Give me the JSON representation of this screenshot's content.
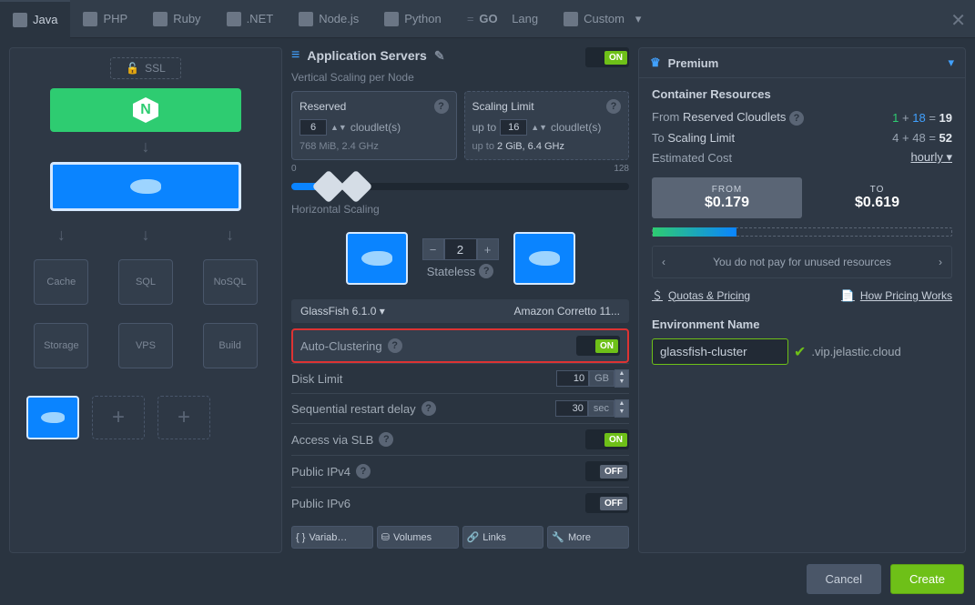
{
  "tabs": [
    "Java",
    "PHP",
    "Ruby",
    ".NET",
    "Node.js",
    "Python",
    "Lang",
    "Custom"
  ],
  "go_prefix": "GO",
  "ssl_label": "SSL",
  "app_servers": {
    "title": "Application Servers",
    "toggle": "ON",
    "vertical_subtitle": "Vertical Scaling per Node",
    "reserved": {
      "title": "Reserved",
      "value": "6",
      "unit": "cloudlet(s)",
      "foot": "768 MiB, 2.4 GHz"
    },
    "limit": {
      "title": "Scaling Limit",
      "prefix": "up to",
      "value": "16",
      "unit": "cloudlet(s)",
      "foot_prefix": "up to",
      "foot": "2 GiB, 6.4 GHz"
    },
    "slider_min": "0",
    "slider_max": "128",
    "horizontal_subtitle": "Horizontal Scaling",
    "count": "2",
    "mode": "Stateless",
    "version": "GlassFish 6.1.0",
    "jdk": "Amazon Corretto 11...",
    "auto_clustering": {
      "label": "Auto-Clustering",
      "toggle": "ON"
    },
    "disk_limit": {
      "label": "Disk Limit",
      "value": "10",
      "unit": "GB"
    },
    "restart_delay": {
      "label": "Sequential restart delay",
      "value": "30",
      "unit": "sec"
    },
    "slb": {
      "label": "Access via SLB",
      "toggle": "ON"
    },
    "ipv4": {
      "label": "Public IPv4",
      "toggle": "OFF"
    },
    "ipv6": {
      "label": "Public IPv6",
      "toggle": "OFF"
    },
    "bottom_buttons": [
      "Variab…",
      "Volumes",
      "Links",
      "More"
    ]
  },
  "topology_arrows_row": [
    "↓",
    "↓",
    "↓"
  ],
  "topology_drop1": [
    "Cache",
    "SQL",
    "NoSQL"
  ],
  "topology_drop2": [
    "Storage",
    "VPS",
    "Build"
  ],
  "premium": {
    "title": "Premium",
    "resources_title": "Container Resources",
    "from_label": "From",
    "reserved_cloudlets": "Reserved Cloudlets",
    "from_calc": {
      "a": "1",
      "b": "18",
      "r": "19"
    },
    "to_label": "To",
    "scaling_limit": "Scaling Limit",
    "to_calc": {
      "a": "4",
      "b": "48",
      "r": "52"
    },
    "est_cost": "Estimated Cost",
    "cost_period": "hourly",
    "from_box": {
      "lab": "FROM",
      "val": "$0.179"
    },
    "to_box": {
      "lab": "TO",
      "val": "$0.619"
    },
    "tip": "You do not pay for unused resources",
    "quotas": "Quotas & Pricing",
    "how": "How Pricing Works",
    "env_title": "Environment Name",
    "env_value": "glassfish-cluster",
    "env_suffix": ".vip.jelastic.cloud"
  },
  "footer": {
    "cancel": "Cancel",
    "create": "Create"
  }
}
